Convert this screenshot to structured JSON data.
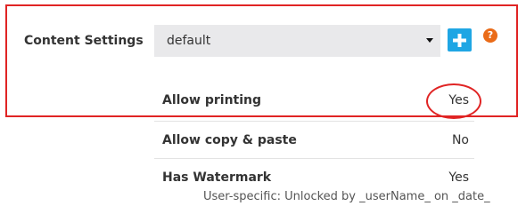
{
  "content_settings": {
    "label": "Content Settings",
    "select": {
      "value": "default"
    },
    "add_button": {
      "icon": "plus-icon"
    },
    "help_icon": {
      "glyph": "?",
      "icon": "question-circle-icon"
    }
  },
  "permissions": [
    {
      "label": "Allow printing",
      "value": "Yes"
    },
    {
      "label": "Allow copy & paste",
      "value": "No"
    },
    {
      "label": "Has Watermark",
      "value": "Yes"
    }
  ],
  "footnote": "User-specific: Unlocked by _userName_ on _date_",
  "colors": {
    "highlight": "#e02424",
    "accent": "#1fa6e4",
    "help": "#ea6b18",
    "select_bg": "#e9e9eb"
  }
}
